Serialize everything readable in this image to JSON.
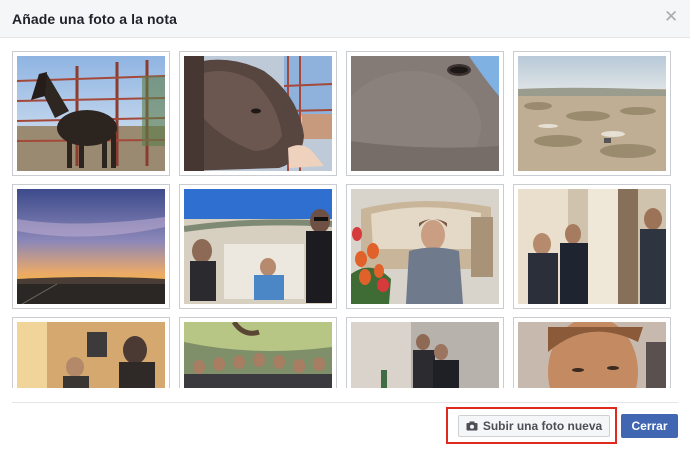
{
  "dialog": {
    "title": "Añade una foto a la nota",
    "close_icon": "close-icon"
  },
  "photos": [
    {
      "subject": "horse-corral"
    },
    {
      "subject": "horse-head-hand"
    },
    {
      "subject": "horse-eye-closeup"
    },
    {
      "subject": "desert-landscape"
    },
    {
      "subject": "sunset-sky"
    },
    {
      "subject": "group-selfie-road"
    },
    {
      "subject": "man-on-sofa-tulips"
    },
    {
      "subject": "men-in-room"
    },
    {
      "subject": "party-people"
    },
    {
      "subject": "crowd-under-tree"
    },
    {
      "subject": "people-dim-room"
    },
    {
      "subject": "man-portrait"
    }
  ],
  "footer": {
    "upload_label": "Subir una foto nueva",
    "upload_icon": "camera-icon",
    "close_label": "Cerrar"
  },
  "colors": {
    "primary_button": "#4267b2",
    "highlight_border": "#e02a1f",
    "header_bg": "#f5f6f7"
  }
}
